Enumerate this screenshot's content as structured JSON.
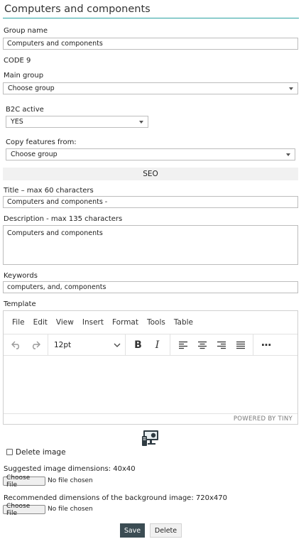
{
  "page": {
    "title": "Computers and components"
  },
  "group_name": {
    "label": "Group name",
    "value": "Computers and components"
  },
  "code": "CODE 9",
  "main_group": {
    "label": "Main group",
    "value": "Choose group"
  },
  "b2c": {
    "label": "B2C active",
    "value": "YES"
  },
  "copy_features": {
    "label": "Copy features from:",
    "value": "Choose group"
  },
  "seo": {
    "heading": "SEO"
  },
  "seo_title": {
    "label": "Title – max 60 characters",
    "value": "Computers and components -"
  },
  "description": {
    "label": "Description - max 135 characters",
    "value": "Computers and components"
  },
  "keywords": {
    "label": "Keywords",
    "value": "computers, and, components"
  },
  "template": {
    "label": "Template",
    "menu": [
      "File",
      "Edit",
      "View",
      "Insert",
      "Format",
      "Tools",
      "Table"
    ],
    "font_size": "12pt",
    "powered_by": "POWERED BY TINY"
  },
  "image": {
    "icon": "computer-icon",
    "delete_label": "Delete image",
    "delete_checked": false,
    "suggested_dims": "Suggested image dimensions: 40x40",
    "recommended_bg": "Recommended dimensions of the background image: 720x470",
    "choose_file": "Choose File",
    "no_file": "No file chosen"
  },
  "actions": {
    "save": "Save",
    "delete": "Delete"
  },
  "colors": {
    "accent_line": "#2aa1a1",
    "save_bg": "#3b4c53"
  }
}
